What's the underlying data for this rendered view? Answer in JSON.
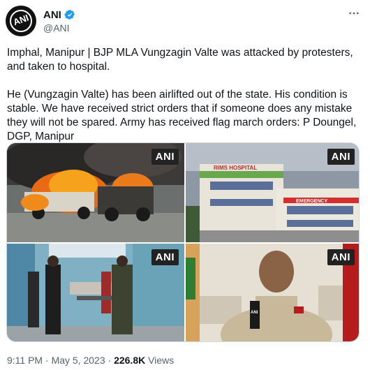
{
  "account": {
    "display_name": "ANI",
    "handle": "@ANI",
    "avatar_text": "ANI",
    "verified": true
  },
  "tweet": {
    "text": "Imphal, Manipur | BJP MLA Vungzagin Valte was attacked by protesters, and taken to hospital.\n\nHe (Vungzagin Valte) has been airlifted out of the state. His condition is stable. We have received strict orders that if someone does any mistake they will not be spared. Army has received flag march orders: P Doungel, DGP, Manipur"
  },
  "media": [
    {
      "name": "burning-vehicles-photo",
      "watermark": "ANI"
    },
    {
      "name": "rims-hospital-photo",
      "watermark": "ANI",
      "sign_text": "RIMS HOSPITAL",
      "sign2": "EMERGENCY"
    },
    {
      "name": "hospital-corridor-photo",
      "watermark": "ANI"
    },
    {
      "name": "dgp-press-photo",
      "watermark": "ANI",
      "mic_text": "ANI"
    }
  ],
  "meta": {
    "time": "9:11 PM",
    "sep1": " · ",
    "date": "May 5, 2023",
    "sep2": " · ",
    "views_count": "226.8K",
    "views_label": " Views"
  },
  "colors": {
    "accent_verified": "#1d9bf0",
    "text_primary": "#0f1419",
    "text_secondary": "#536471"
  },
  "icons": {
    "more": "more-horizontal-icon",
    "verified": "verified-badge-icon"
  }
}
